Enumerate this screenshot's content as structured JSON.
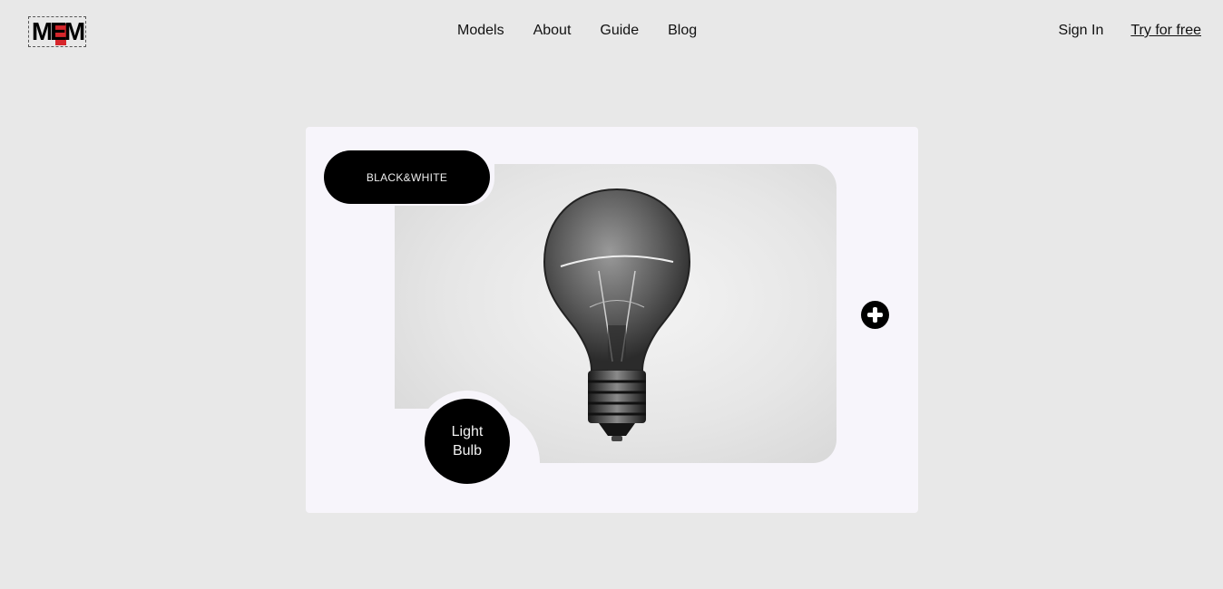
{
  "header": {
    "logo_text": "MEM",
    "nav": [
      "Models",
      "About",
      "Guide",
      "Blog"
    ],
    "sign_in": "Sign In",
    "try_free": "Try for free"
  },
  "card": {
    "badge": "BLACK&WHITE",
    "circle_line1": "Light",
    "circle_line2": "Bulb",
    "photo_subject": "light-bulb",
    "add_icon": "plus-circle-icon"
  },
  "colors": {
    "background": "#e8e8e8",
    "card": "#f7f5fb",
    "logo_accent": "#d6262b",
    "badge": "#000000"
  }
}
